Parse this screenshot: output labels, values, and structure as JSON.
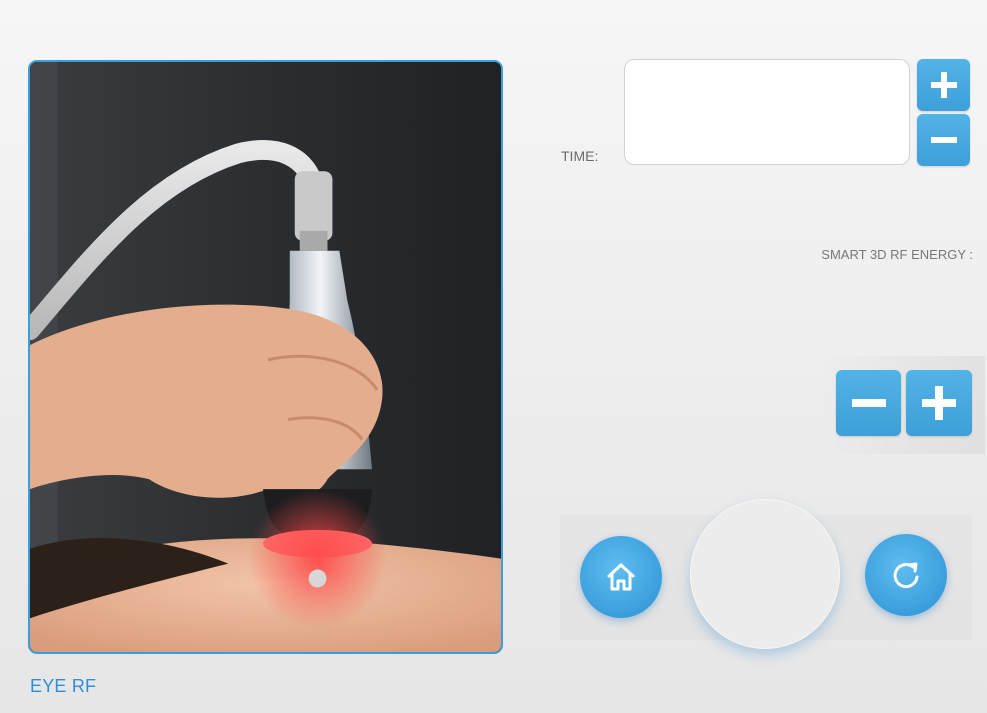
{
  "mode": {
    "caption": "EYE RF"
  },
  "time": {
    "label": "TIME:",
    "value": ""
  },
  "energy": {
    "label": "SMART 3D RF ENERGY :",
    "value": ""
  },
  "controls": {
    "time_increase_icon": "plus-icon",
    "time_decrease_icon": "minus-icon",
    "energy_decrease_icon": "minus-icon",
    "energy_increase_icon": "plus-icon",
    "home_icon": "home-icon",
    "reset_icon": "refresh-icon"
  },
  "colors": {
    "accent": "#3e9fd9",
    "caption": "#2e8fd6",
    "frame_border": "#3a9fd8"
  }
}
